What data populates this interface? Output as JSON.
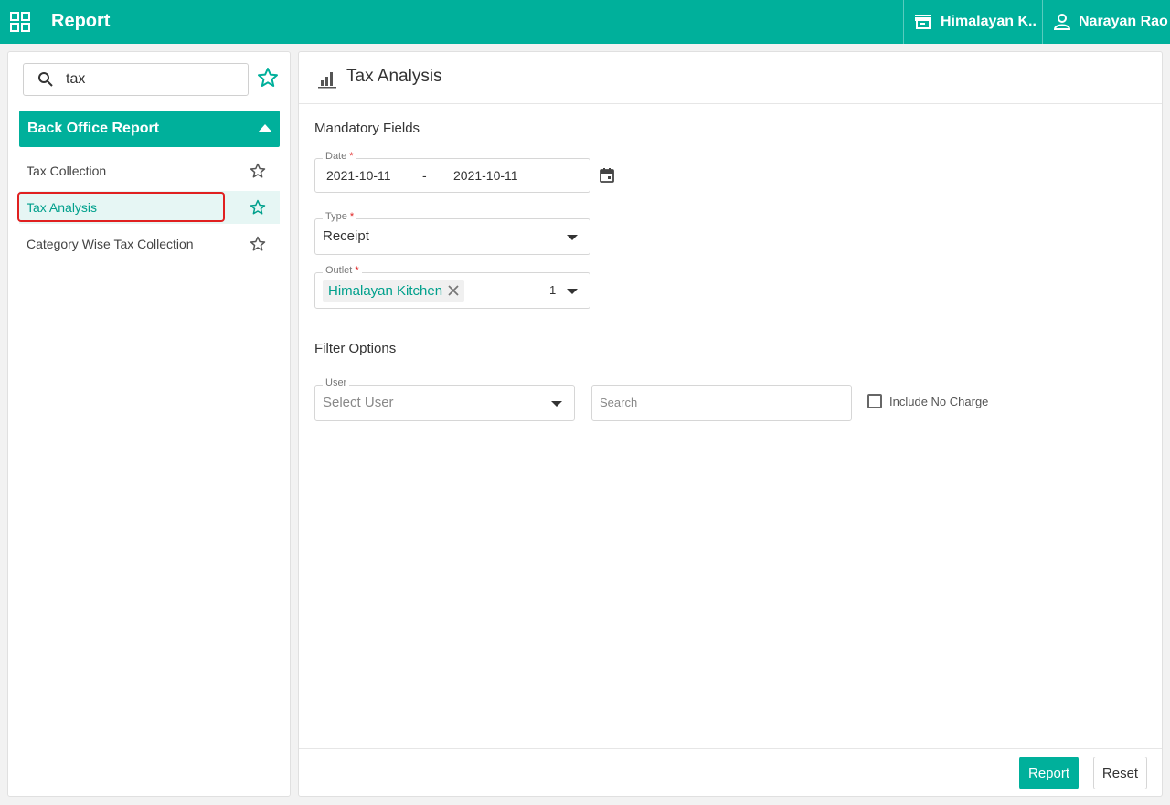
{
  "topbar": {
    "title": "Report",
    "store_name": "Himalayan K...",
    "user_name": "Narayan Rao"
  },
  "sidebar": {
    "search_value": "tax",
    "section_title": "Back Office Report",
    "items": [
      {
        "label": "Tax Collection"
      },
      {
        "label": "Tax Analysis"
      },
      {
        "label": "Category Wise Tax Collection"
      }
    ]
  },
  "main": {
    "title": "Tax Analysis",
    "mandatory_title": "Mandatory Fields",
    "date": {
      "label": "Date",
      "required_mark": "*",
      "from": "2021-10-11",
      "separator": "-",
      "to": "2021-10-11"
    },
    "type": {
      "label": "Type",
      "required_mark": "*",
      "value": "Receipt"
    },
    "outlet": {
      "label": "Outlet",
      "required_mark": "*",
      "chip": "Himalayan Kitchen",
      "count": "1"
    },
    "filter_title": "Filter Options",
    "user": {
      "label": "User",
      "placeholder": "Select User"
    },
    "search_placeholder": "Search",
    "include_no_charge": "Include No Charge",
    "report_button": "Report",
    "reset_button": "Reset"
  },
  "colors": {
    "accent": "#00b09b",
    "highlight": "#e02020"
  }
}
